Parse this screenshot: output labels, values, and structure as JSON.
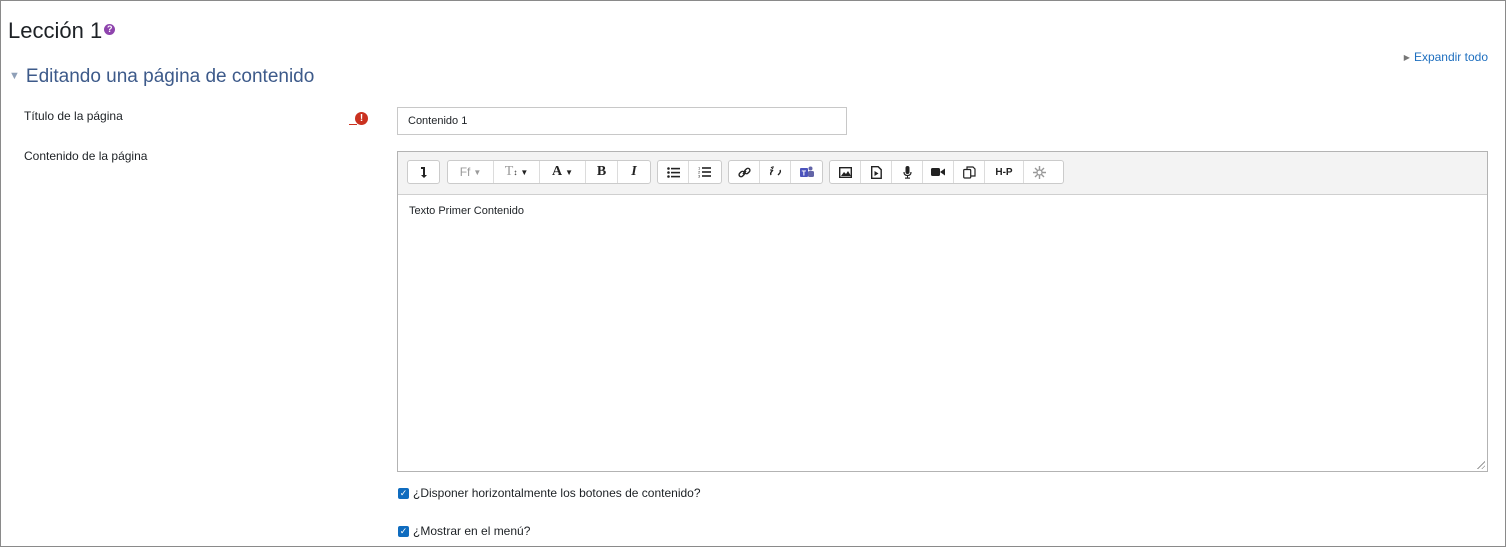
{
  "page": {
    "title": "Lección 1",
    "help_icon": "question-circle-icon"
  },
  "header": {
    "expand_all_label": "Expandir todo"
  },
  "section": {
    "title": "Editando una página de contenido",
    "collapse_icon": "caret-down-icon"
  },
  "form": {
    "page_title_label": "Título de la página",
    "page_title_value": "Contenido 1",
    "required_icon": "exclamation-circle-icon",
    "page_content_label": "Contenido de la página",
    "page_content_value": "Texto Primer Contenido"
  },
  "toolbar": {
    "buttons": [
      {
        "name": "toolbar-toggle-button",
        "label": "↴"
      },
      {
        "name": "font-family-button",
        "label": "Ff"
      },
      {
        "name": "font-size-button",
        "label": "T"
      },
      {
        "name": "font-color-button",
        "label": "A"
      },
      {
        "name": "bold-button",
        "label": "B"
      },
      {
        "name": "italic-button",
        "label": "I"
      },
      {
        "name": "unordered-list-button",
        "icon": "list-ul-icon"
      },
      {
        "name": "ordered-list-button",
        "icon": "list-ol-icon"
      },
      {
        "name": "link-button",
        "icon": "link-icon"
      },
      {
        "name": "unlink-button",
        "icon": "unlink-icon"
      },
      {
        "name": "teams-meeting-button",
        "icon": "teams-icon"
      },
      {
        "name": "image-button",
        "icon": "image-icon"
      },
      {
        "name": "media-button",
        "icon": "file-media-icon"
      },
      {
        "name": "record-audio-button",
        "icon": "microphone-icon"
      },
      {
        "name": "record-video-button",
        "icon": "video-camera-icon"
      },
      {
        "name": "manage-files-button",
        "icon": "copy-files-icon"
      },
      {
        "name": "h5p-button",
        "label": "H-P"
      },
      {
        "name": "accessibility-button",
        "icon": "accessibility-icon"
      }
    ]
  },
  "options": {
    "horizontal_buttons_label": "¿Disponer horizontalmente los botones de contenido?",
    "horizontal_buttons_checked": true,
    "show_in_menu_label": "¿Mostrar en el menú?",
    "show_in_menu_checked": true
  },
  "colors": {
    "accent": "#0f6cbf",
    "section_title": "#3d5a8a",
    "required": "#ca3120",
    "help": "#8e44ad"
  }
}
